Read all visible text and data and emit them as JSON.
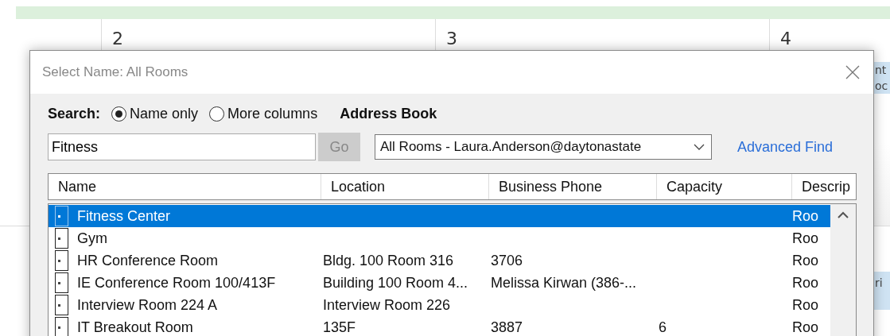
{
  "calendar": {
    "days": [
      "2",
      "3",
      "4"
    ],
    "events": [
      {
        "lines": [
          "nt",
          "oc"
        ]
      },
      {
        "lines": [
          "ri"
        ]
      }
    ]
  },
  "dialog": {
    "title": "Select Name: All Rooms",
    "search_label": "Search:",
    "search_modes": [
      {
        "label": "Name only",
        "selected": true
      },
      {
        "label": "More columns",
        "selected": false
      }
    ],
    "address_book_label": "Address Book",
    "search_field": {
      "value": "Fitness"
    },
    "go_button": {
      "label": "Go",
      "disabled": true
    },
    "address_book": {
      "value": "All Rooms - Laura.Anderson@daytonastate"
    },
    "advanced_find": "Advanced Find",
    "table": {
      "columns": [
        "Name",
        "Location",
        "Business Phone",
        "Capacity",
        "Descrip"
      ],
      "rows": [
        {
          "name": "Fitness Center",
          "location": "",
          "phone": "",
          "capacity": "",
          "description": "Roo",
          "selected": true
        },
        {
          "name": "Gym",
          "location": "",
          "phone": "",
          "capacity": "",
          "description": "Roo",
          "selected": false
        },
        {
          "name": "HR Conference Room",
          "location": "Bldg. 100 Room 316",
          "phone": "3706",
          "capacity": "",
          "description": "Roo",
          "selected": false
        },
        {
          "name": "IE Conference Room 100/413F",
          "location": "Building 100 Room 4...",
          "phone": "Melissa Kirwan (386-...",
          "capacity": "",
          "description": "Roo",
          "selected": false
        },
        {
          "name": "Interview Room 224 A",
          "location": "Interview Room 226",
          "phone": "",
          "capacity": "",
          "description": "Roo",
          "selected": false
        },
        {
          "name": "IT Breakout Room",
          "location": "135F",
          "phone": "3887",
          "capacity": "6",
          "description": "Roo",
          "selected": false
        }
      ]
    }
  }
}
